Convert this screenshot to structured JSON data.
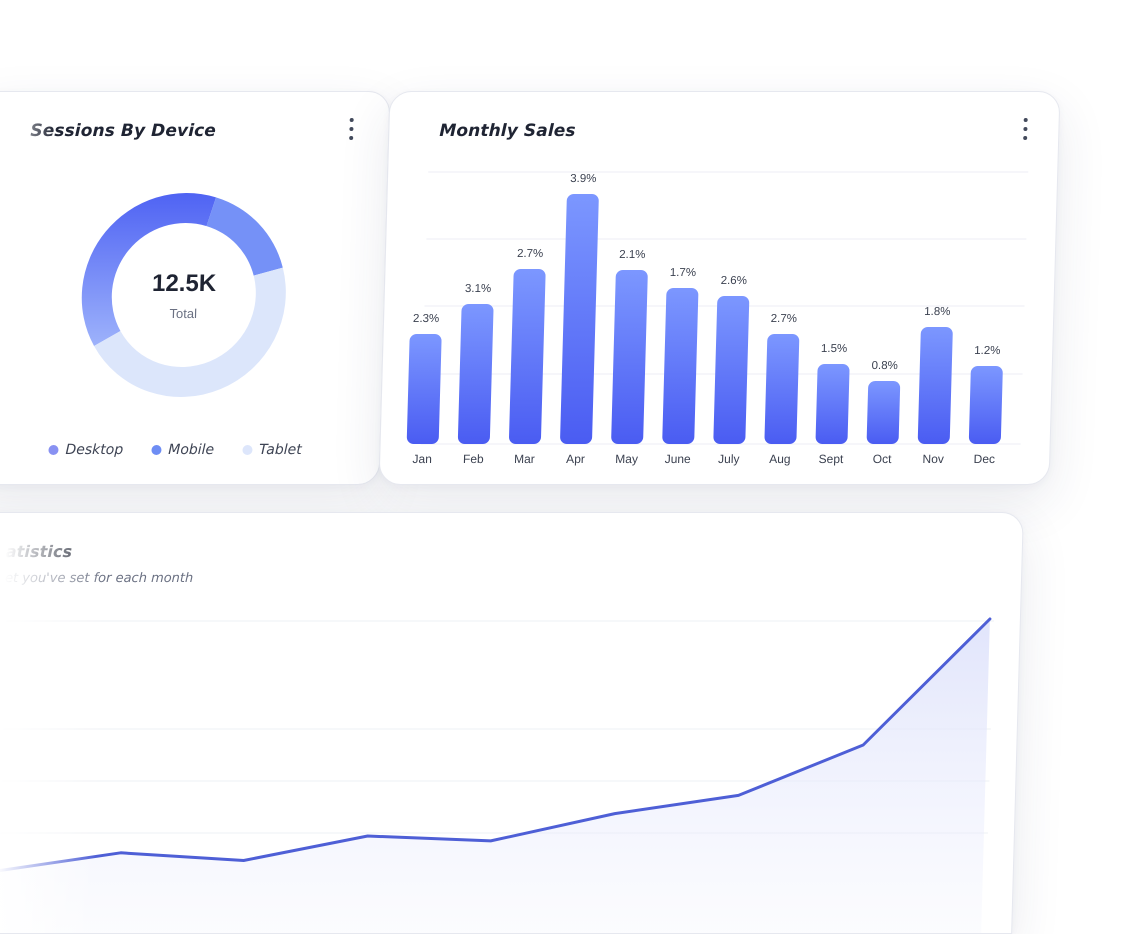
{
  "sessions_card": {
    "title": "Sessions By Device",
    "total_value": "12.5K",
    "total_label": "Total",
    "legend": [
      {
        "label": "Desktop",
        "color": "#8891f2"
      },
      {
        "label": "Mobile",
        "color": "#6e8df4"
      },
      {
        "label": "Tablet",
        "color": "#dde6fb"
      }
    ]
  },
  "sales_card": {
    "title": "Monthly Sales"
  },
  "stats_card": {
    "title": "atistics",
    "subtitle": "et you've set for each month"
  },
  "colors": {
    "bar_top": "#7c97ff",
    "bar_bottom": "#4a5cf2",
    "line": "#4e5fd6",
    "donut_desktop": "#4f63f3",
    "donut_mobile": "#7591f7",
    "donut_tablet": "#dce6fb"
  },
  "chart_data": [
    {
      "type": "pie",
      "title": "Sessions By Device",
      "categories": [
        "Desktop",
        "Mobile",
        "Tablet"
      ],
      "values": [
        38,
        16,
        46
      ],
      "center_value": "12.5K",
      "center_label": "Total",
      "legend_position": "bottom"
    },
    {
      "type": "bar",
      "title": "Monthly Sales",
      "categories": [
        "Jan",
        "Feb",
        "Mar",
        "Apr",
        "May",
        "June",
        "July",
        "Aug",
        "Sept",
        "Oct",
        "Nov",
        "Dec"
      ],
      "values": [
        2.3,
        3.1,
        2.7,
        3.9,
        2.1,
        1.7,
        2.6,
        2.7,
        1.5,
        0.8,
        1.8,
        1.2
      ],
      "data_labels": [
        "2.3%",
        "3.1%",
        "2.7%",
        "3.9%",
        "2.1%",
        "1.7%",
        "2.6%",
        "2.7%",
        "1.5%",
        "0.8%",
        "1.8%",
        "1.2%"
      ],
      "bar_heights": [
        110,
        140,
        175,
        250,
        174,
        156,
        148,
        110,
        80,
        63,
        117,
        78
      ],
      "grid": true
    },
    {
      "type": "area",
      "title": "atistics",
      "values": [
        10,
        36,
        25,
        60,
        53,
        92,
        118,
        190,
        370
      ]
    }
  ]
}
